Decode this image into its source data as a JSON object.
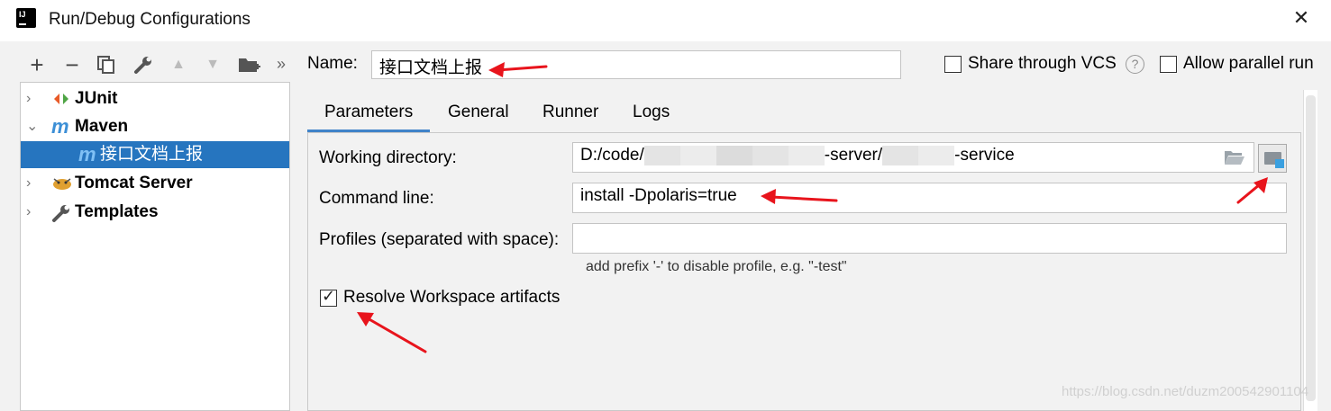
{
  "window": {
    "title": "Run/Debug Configurations",
    "close_glyph": "✕"
  },
  "toolbar": {
    "add": "+",
    "remove": "−",
    "copy_icon": "copy-icon",
    "settings_icon": "wrench-icon",
    "up": "▲",
    "down": "▼",
    "folder_icon": "new-folder-icon",
    "more": "»"
  },
  "tree": {
    "items": [
      {
        "label": "JUnit",
        "chevron": "›",
        "icon": "junit-icon"
      },
      {
        "label": "Maven",
        "chevron": "⌄",
        "icon": "maven-icon"
      },
      {
        "label": "接口文档上报",
        "icon": "maven-icon",
        "selected": true
      },
      {
        "label": "Tomcat Server",
        "chevron": "›",
        "icon": "tomcat-icon"
      },
      {
        "label": "Templates",
        "chevron": "›",
        "icon": "wrench-icon"
      }
    ]
  },
  "header": {
    "name_label": "Name:",
    "name_value": "接口文档上报",
    "share_label": "Share through VCS",
    "share_checked": false,
    "help_glyph": "?",
    "parallel_label": "Allow parallel run",
    "parallel_checked": false
  },
  "tabs": [
    {
      "label": "Parameters",
      "active": true
    },
    {
      "label": "General"
    },
    {
      "label": "Runner"
    },
    {
      "label": "Logs"
    }
  ],
  "parameters": {
    "working_dir_label": "Working directory:",
    "working_dir_prefix": "D:/code/",
    "working_dir_middle": "-server/",
    "working_dir_suffix": "-service",
    "command_line_label": "Command line:",
    "command_line_value": "install -Dpolaris=true",
    "profiles_label": "Profiles (separated with space):",
    "profiles_value": "",
    "profiles_hint": "add prefix '-' to disable profile, e.g. \"-test\"",
    "resolve_label": "Resolve Workspace artifacts",
    "resolve_checked": true
  },
  "watermark": "https://blog.csdn.net/duzm200542901104",
  "colors": {
    "selection": "#2675bf",
    "tab_underline": "#4083c9",
    "annotation_arrow": "#e8141c"
  }
}
